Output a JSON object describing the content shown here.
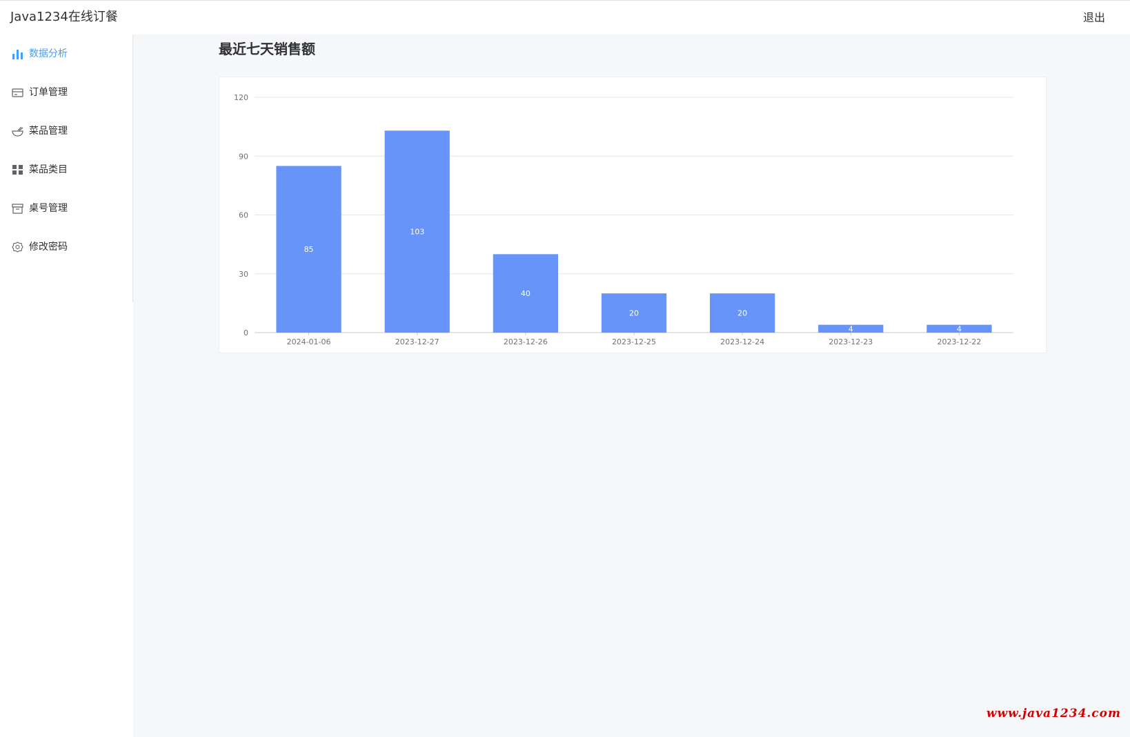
{
  "app": {
    "title": "Java1234在线订餐",
    "logout_label": "退出"
  },
  "sidebar": {
    "items": [
      {
        "label": "数据分析",
        "icon": "bar-chart-icon",
        "active": true
      },
      {
        "label": "订单管理",
        "icon": "card-icon",
        "active": false
      },
      {
        "label": "菜品管理",
        "icon": "bowl-icon",
        "active": false
      },
      {
        "label": "菜品类目",
        "icon": "grid-icon",
        "active": false
      },
      {
        "label": "桌号管理",
        "icon": "box-icon",
        "active": false
      },
      {
        "label": "修改密码",
        "icon": "gear-icon",
        "active": false
      }
    ]
  },
  "main": {
    "title": "最近七天销售额"
  },
  "colors": {
    "accent": "#409eff",
    "bar": "#6694f8",
    "background": "#f6f7f9",
    "watermark": "#d40000"
  },
  "chart_data": {
    "type": "bar",
    "categories": [
      "2024-01-06",
      "2023-12-27",
      "2023-12-26",
      "2023-12-25",
      "2023-12-24",
      "2023-12-23",
      "2023-12-22"
    ],
    "values": [
      85,
      103,
      40,
      20,
      20,
      4,
      4
    ],
    "yticks": [
      "0",
      "30",
      "60",
      "90",
      "120"
    ],
    "ylim": [
      0,
      120
    ],
    "grid": true,
    "data_labels": "inside"
  },
  "watermark": "www.java1234.com"
}
